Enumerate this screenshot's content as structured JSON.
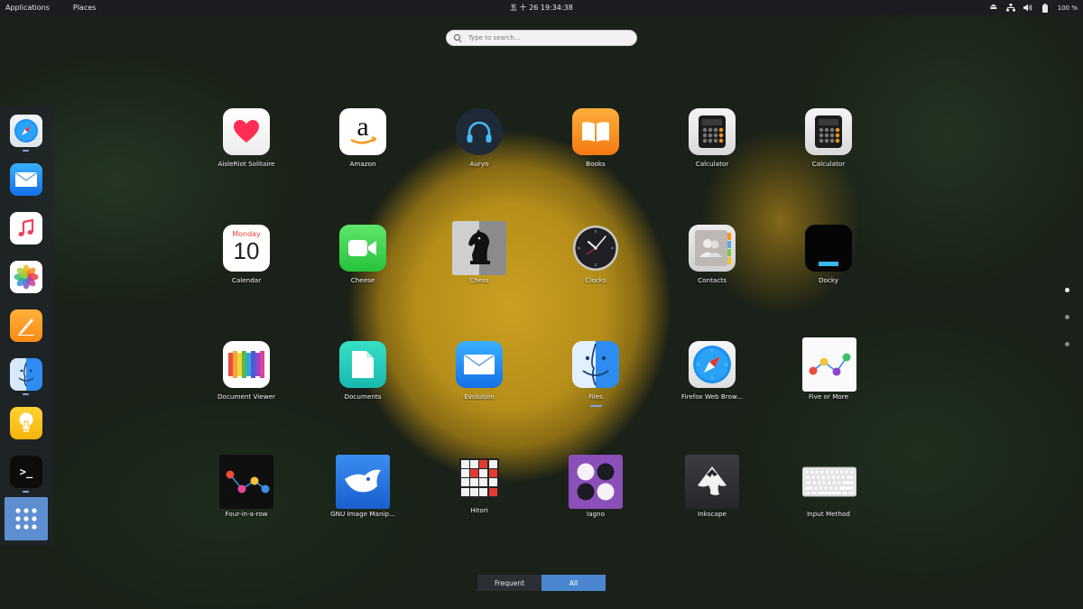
{
  "topbar": {
    "applications": "Applications",
    "places": "Places",
    "clock": "五 十 26  19:34:38",
    "battery": "100 %"
  },
  "search": {
    "placeholder": "Type to search..."
  },
  "dock": {
    "items": [
      {
        "name": "safari",
        "running": true
      },
      {
        "name": "mail",
        "running": false
      },
      {
        "name": "music",
        "running": false
      },
      {
        "name": "photos",
        "running": false
      },
      {
        "name": "notes",
        "running": false
      },
      {
        "name": "finder",
        "running": true
      },
      {
        "name": "lightbulb",
        "running": false
      },
      {
        "name": "terminal",
        "running": true
      }
    ],
    "show_apps": "show-applications"
  },
  "apps": [
    {
      "label": "AisleRiot Solitaire"
    },
    {
      "label": "Amazon"
    },
    {
      "label": "Auryo"
    },
    {
      "label": "Books"
    },
    {
      "label": "Calculator"
    },
    {
      "label": "Calculator"
    },
    {
      "label": "Calendar",
      "icon_text_month": "Monday",
      "icon_text_day": "10"
    },
    {
      "label": "Cheese"
    },
    {
      "label": "Chess"
    },
    {
      "label": "Clocks"
    },
    {
      "label": "Contacts"
    },
    {
      "label": "Docky"
    },
    {
      "label": "Document Viewer"
    },
    {
      "label": "Documents"
    },
    {
      "label": "Evolution"
    },
    {
      "label": "Files",
      "running": true
    },
    {
      "label": "Firefox Web Brow..."
    },
    {
      "label": "Five or More"
    },
    {
      "label": "Four-in-a-row"
    },
    {
      "label": "GNU Image Manip..."
    },
    {
      "label": "Hitori"
    },
    {
      "label": "Iagno"
    },
    {
      "label": "Inkscape"
    },
    {
      "label": "Input Method"
    }
  ],
  "pages": {
    "count": 3,
    "current": 1
  },
  "view_switch": {
    "frequent": "Frequent",
    "all": "All",
    "selected": "All"
  },
  "colors": {
    "accent": "#4a86d0",
    "topbar": "#1b1d21"
  }
}
